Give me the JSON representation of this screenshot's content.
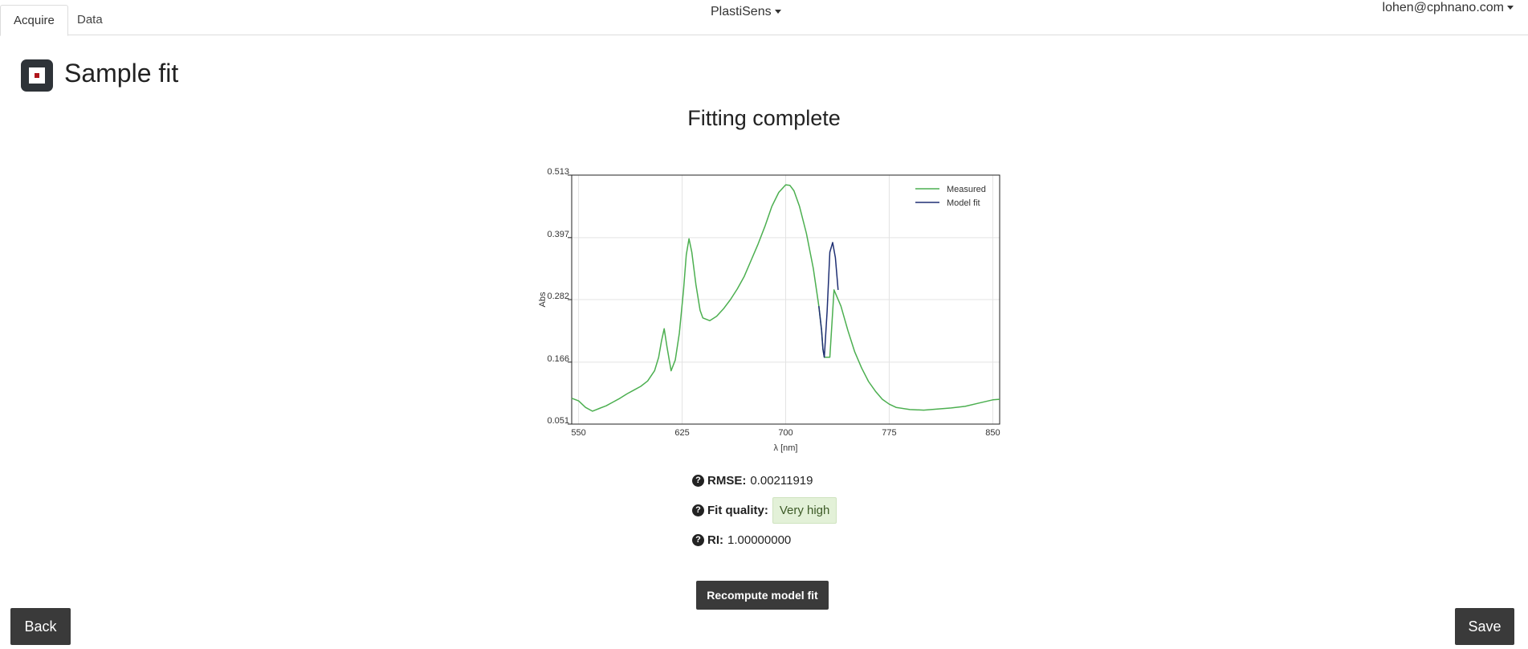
{
  "nav": {
    "tabs": [
      {
        "label": "Acquire",
        "active": true
      },
      {
        "label": "Data",
        "active": false
      }
    ],
    "brand": "PlastiSens",
    "user": "lohen@cphnano.com"
  },
  "header": {
    "title": "Sample fit",
    "icon": "stop-square-icon"
  },
  "status_title": "Fitting complete",
  "chart_data": {
    "type": "line",
    "xlabel": "λ [nm]",
    "ylabel": "Abs",
    "xlim": [
      545,
      855
    ],
    "ylim": [
      0.051,
      0.513
    ],
    "x_ticks": [
      "550",
      "625",
      "700",
      "775",
      "850"
    ],
    "y_ticks": [
      "0.513",
      "0.397",
      "0.282",
      "0.166",
      "0.051"
    ],
    "grid": true,
    "legend_position": "top-right",
    "series": [
      {
        "name": "Measured",
        "color": "#4caf50",
        "x": [
          545,
          550,
          555,
          560,
          565,
          570,
          575,
          580,
          585,
          590,
          595,
          600,
          605,
          608,
          610,
          612,
          614,
          617,
          620,
          623,
          626,
          628,
          630,
          632,
          635,
          638,
          640,
          645,
          650,
          655,
          660,
          665,
          670,
          675,
          680,
          685,
          690,
          695,
          700,
          703,
          706,
          710,
          715,
          720,
          724,
          726,
          727,
          728,
          730,
          732,
          735,
          740,
          745,
          750,
          755,
          760,
          765,
          770,
          775,
          780,
          790,
          800,
          810,
          820,
          830,
          840,
          850,
          855
        ],
        "values": [
          0.099,
          0.094,
          0.082,
          0.075,
          0.08,
          0.085,
          0.092,
          0.099,
          0.107,
          0.114,
          0.121,
          0.131,
          0.15,
          0.175,
          0.205,
          0.228,
          0.195,
          0.15,
          0.17,
          0.22,
          0.3,
          0.365,
          0.395,
          0.37,
          0.31,
          0.262,
          0.248,
          0.243,
          0.251,
          0.265,
          0.282,
          0.302,
          0.325,
          0.355,
          0.385,
          0.418,
          0.455,
          0.481,
          0.495,
          0.494,
          0.484,
          0.455,
          0.405,
          0.34,
          0.27,
          0.225,
          0.19,
          0.175,
          0.175,
          0.175,
          0.3,
          0.27,
          0.225,
          0.185,
          0.155,
          0.13,
          0.112,
          0.097,
          0.088,
          0.082,
          0.078,
          0.077,
          0.079,
          0.081,
          0.084,
          0.09,
          0.096,
          0.097
        ]
      },
      {
        "name": "Model fit",
        "color": "#1f2f73",
        "x": [
          724,
          726,
          727,
          728,
          730,
          732,
          734,
          736,
          738
        ],
        "values": [
          0.27,
          0.225,
          0.19,
          0.175,
          0.26,
          0.37,
          0.388,
          0.36,
          0.3
        ]
      }
    ]
  },
  "stats": {
    "rmse_label": "RMSE:",
    "rmse_value": "0.00211919",
    "fit_quality_label": "Fit quality:",
    "fit_quality_value": "Very high",
    "ri_label": "RI:",
    "ri_value": "1.00000000",
    "help_icon": "question-circle-icon"
  },
  "buttons": {
    "recompute": "Recompute model fit",
    "back": "Back",
    "save": "Save"
  }
}
